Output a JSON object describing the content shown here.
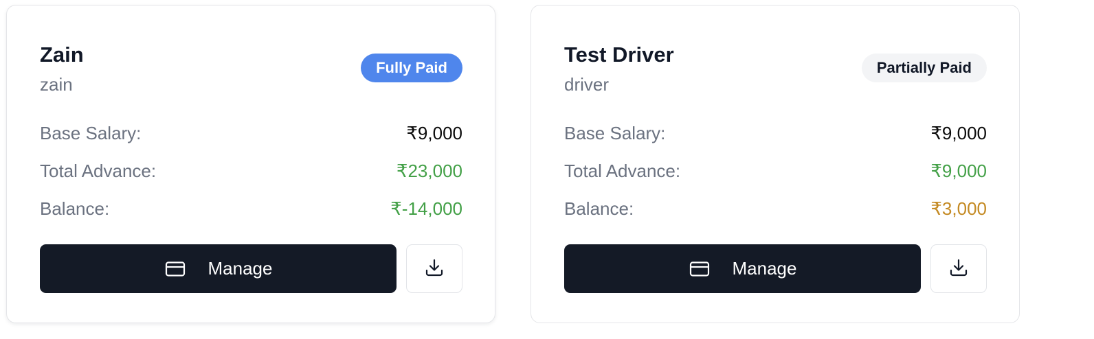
{
  "cards": [
    {
      "name": "Zain",
      "username": "zain",
      "status": "Fully Paid",
      "base_salary_label": "Base Salary:",
      "base_salary": "₹9,000",
      "total_advance_label": "Total Advance:",
      "total_advance": "₹23,000",
      "balance_label": "Balance:",
      "balance": "₹-14,000",
      "manage_label": "Manage",
      "manage_icon": "credit-card-icon",
      "download_icon": "download-icon"
    },
    {
      "name": "Test Driver",
      "username": "driver",
      "status": "Partially Paid",
      "base_salary_label": "Base Salary:",
      "base_salary": "₹9,000",
      "total_advance_label": "Total Advance:",
      "total_advance": "₹9,000",
      "balance_label": "Balance:",
      "balance": "₹3,000",
      "manage_label": "Manage",
      "manage_icon": "credit-card-icon",
      "download_icon": "download-icon"
    }
  ],
  "colors": {
    "fully_paid_badge": "#4f86ec",
    "partially_paid_badge": "#f3f4f6",
    "advance_green": "#43a047",
    "negative_balance_green": "#43a047",
    "positive_balance_amber": "#c48a23",
    "primary_button": "#141a26",
    "muted_text": "#6b7280"
  }
}
